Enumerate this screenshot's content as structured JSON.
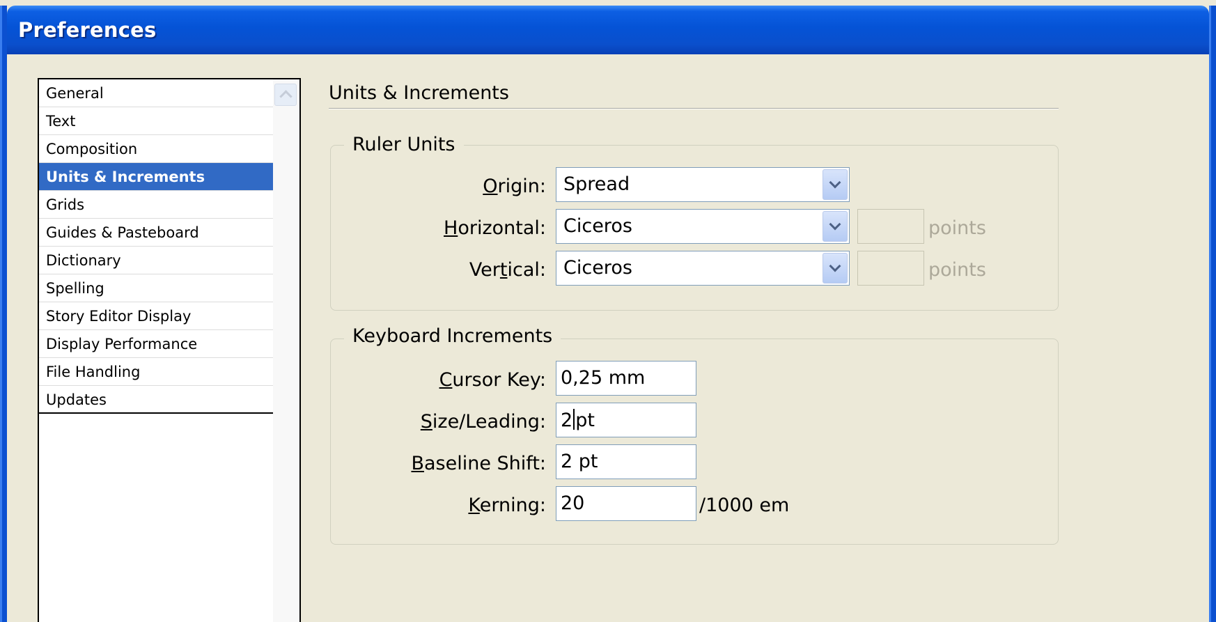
{
  "window": {
    "title": "Preferences"
  },
  "sidebar": {
    "items": [
      {
        "label": "General"
      },
      {
        "label": "Text"
      },
      {
        "label": "Composition"
      },
      {
        "label": "Units & Increments",
        "selected": true
      },
      {
        "label": "Grids"
      },
      {
        "label": "Guides & Pasteboard"
      },
      {
        "label": "Dictionary"
      },
      {
        "label": "Spelling"
      },
      {
        "label": "Story Editor Display"
      },
      {
        "label": "Display Performance"
      },
      {
        "label": "File Handling"
      },
      {
        "label": "Updates"
      }
    ]
  },
  "main": {
    "title": "Units & Increments",
    "ruler_units": {
      "legend": "Ruler Units",
      "origin": {
        "label_pre": "",
        "label_mnemonic": "O",
        "label_post": "rigin:",
        "value": "Spread"
      },
      "horizontal": {
        "label_pre": "",
        "label_mnemonic": "H",
        "label_post": "orizontal:",
        "value": "Ciceros",
        "unit": "points"
      },
      "vertical": {
        "label_pre": "Ver",
        "label_mnemonic": "t",
        "label_post": "ical:",
        "value": "Ciceros",
        "unit": "points"
      }
    },
    "keyboard_increments": {
      "legend": "Keyboard Increments",
      "cursor_key": {
        "label_pre": "",
        "label_mnemonic": "C",
        "label_post": "ursor Key:",
        "value": "0,25 mm"
      },
      "size_leading": {
        "label_pre": "",
        "label_mnemonic": "S",
        "label_post": "ize/Leading:",
        "value_before_caret": "2",
        "value_after_caret": "pt"
      },
      "baseline_shift": {
        "label_pre": "",
        "label_mnemonic": "B",
        "label_post": "aseline Shift:",
        "value": "2 pt"
      },
      "kerning": {
        "label_pre": "",
        "label_mnemonic": "K",
        "label_post": "erning:",
        "value": "20",
        "unit": "/1000 em"
      }
    }
  },
  "icons": {
    "dropdown": "chevron-down-icon",
    "scroll_up": "chevron-up-icon"
  }
}
